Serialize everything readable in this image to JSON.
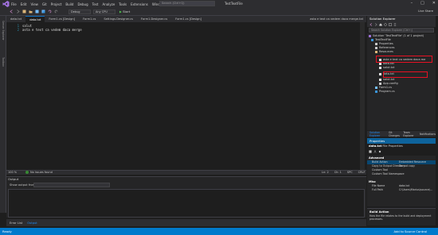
{
  "window": {
    "title": "TestTextFile",
    "search_placeholder": "Search (Ctrl+Q)",
    "menu": [
      "File",
      "Edit",
      "View",
      "Git",
      "Project",
      "Build",
      "Debug",
      "Test",
      "Analyze",
      "Tools",
      "Extensions",
      "Window",
      "Help"
    ]
  },
  "toolbar": {
    "configuration": "Debug",
    "platform": "Any CPU",
    "start_label": "Start",
    "live_share": "Live Share"
  },
  "left_strip": [
    "Server Explorer",
    "Toolbox"
  ],
  "editor": {
    "tabs": [
      "data.txt",
      "data.txt",
      "Form1.cs [Design]",
      "Form1.cs",
      "Settings.Designer.cs",
      "Form1.Designer.cs",
      "Form1.cs [Design]"
    ],
    "active_tab_index": 1,
    "extra_tab": "asta e text ca vedem daca merge.txt",
    "lines": [
      "salut",
      "asta e text ca vedem daca merge"
    ],
    "zoom": "100 %",
    "issues": "No issues found",
    "line": "Ln: 2",
    "column": "Ch: 1",
    "eol": "CRLF",
    "mode": "SPC"
  },
  "output": {
    "title": "Output",
    "show_from_label": "Show output from:"
  },
  "bottom_tabs": [
    "Error List",
    "Output"
  ],
  "bottom_tabs_active": 1,
  "solution_explorer": {
    "title": "Solution Explorer",
    "search_placeholder": "Search Solution Explorer (Ctrl+;)",
    "nodes": [
      {
        "label": "Solution 'TestTextFile' (1 of 1 project)",
        "level": 0
      },
      {
        "label": "TestTextFile",
        "level": 1
      },
      {
        "label": "Properties",
        "level": 2
      },
      {
        "label": "References",
        "level": 2
      },
      {
        "label": "Resources",
        "level": 2
      },
      {
        "label": "asta e text ca vedem daca me",
        "level": 3
      },
      {
        "label": "data.txt",
        "level": 3
      },
      {
        "label": "salut.txt",
        "level": 3
      },
      {
        "label": "data.txt",
        "level": 2
      },
      {
        "label": "salut.txt",
        "level": 2
      },
      {
        "label": "App.config",
        "level": 2
      },
      {
        "label": "Form1.cs",
        "level": 2
      },
      {
        "label": "Program.cs",
        "level": 2
      }
    ],
    "bottom_tabs": [
      "Solution Explorer",
      "Git Changes",
      "Team Explorer",
      "Notifications"
    ],
    "highlight_color": "#e81123"
  },
  "properties": {
    "title": "Properties",
    "object_name": "data.txt",
    "object_type": "File Properties",
    "categories": [
      {
        "name": "Advanced",
        "rows": [
          {
            "key": "Build Action",
            "value": "Embedded Resource",
            "selected": true
          },
          {
            "key": "Copy to Output Directory",
            "value": "Do not copy"
          },
          {
            "key": "Custom Tool",
            "value": ""
          },
          {
            "key": "Custom Tool Namespace",
            "value": ""
          }
        ]
      },
      {
        "name": "Misc",
        "rows": [
          {
            "key": "File Name",
            "value": "data.txt"
          },
          {
            "key": "Full Path",
            "value": "C:\\Users\\Marius\\source\\..."
          }
        ]
      }
    ],
    "desc_title": "Build Action",
    "desc_text": "How the file relates to the build and deployment processes."
  },
  "statusbar": {
    "ready": "Ready",
    "source_control": "Add to Source Control"
  },
  "colors": {
    "accent": "#007acc",
    "highlight": "#e81123",
    "selection": "#094771"
  }
}
